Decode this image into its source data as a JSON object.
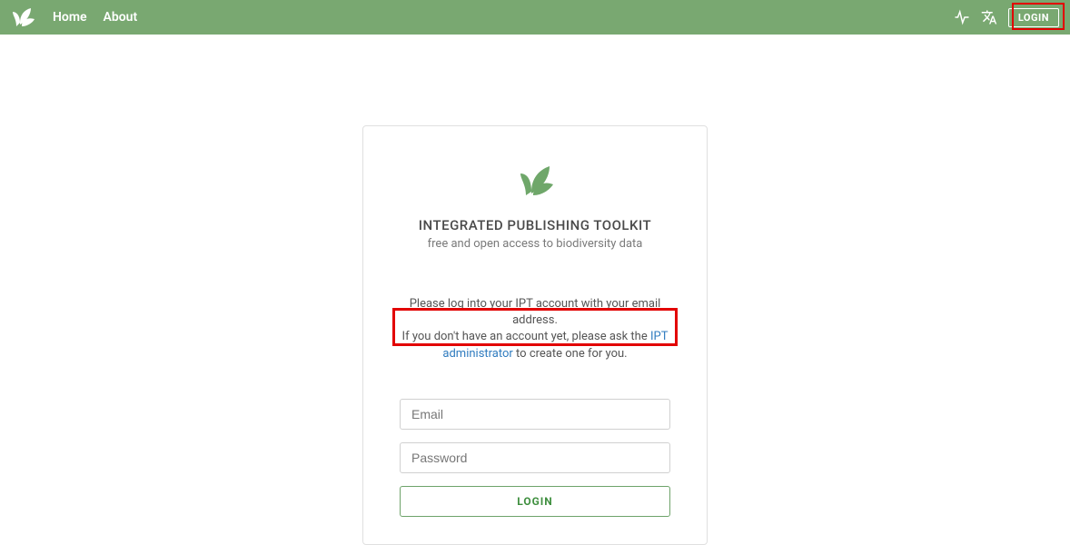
{
  "navbar": {
    "home": "Home",
    "about": "About",
    "login": "LOGIN"
  },
  "card": {
    "title": "INTEGRATED PUBLISHING TOOLKIT",
    "subtitle": "free and open access to biodiversity data",
    "instruction_line1": "Please log into your IPT account with your email address.",
    "instruction_line2a": "If you don't have an account yet, please ask the ",
    "admin_link": "IPT administrator",
    "instruction_line2b": " to create one for you."
  },
  "form": {
    "email_placeholder": "Email",
    "password_placeholder": "Password",
    "submit": "LOGIN"
  }
}
